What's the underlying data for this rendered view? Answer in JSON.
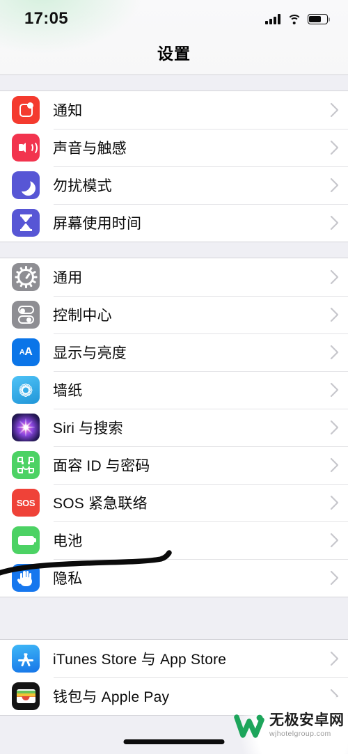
{
  "status_bar": {
    "time": "17:05",
    "signal_icon": "cellular-bars-icon",
    "wifi_icon": "wifi-icon",
    "battery_icon": "battery-icon",
    "battery_level": 62
  },
  "header": {
    "title": "设置"
  },
  "colors": {
    "page_background": "#EFEFF4",
    "row_background": "#FFFFFF",
    "separator": "#E3E3E6",
    "chevron": "#C7C7CC",
    "label": "#0A0A0A",
    "annotation": "#0B0B0B"
  },
  "groups": [
    {
      "id": "group-alerts",
      "rows": [
        {
          "label": "通知",
          "icon": "notifications-icon",
          "icon_color": "#F43A2E"
        },
        {
          "label": "声音与触感",
          "icon": "sounds-haptics-icon",
          "icon_color": "#F2344E"
        },
        {
          "label": "勿扰模式",
          "icon": "do-not-disturb-icon",
          "icon_color": "#5756D5"
        },
        {
          "label": "屏幕使用时间",
          "icon": "screen-time-icon",
          "icon_color": "#5756D5"
        }
      ]
    },
    {
      "id": "group-system",
      "rows": [
        {
          "label": "通用",
          "icon": "gear-icon",
          "icon_color": "#8E8E93"
        },
        {
          "label": "控制中心",
          "icon": "control-center-icon",
          "icon_color": "#8E8E93"
        },
        {
          "label": "显示与亮度",
          "icon": "display-brightness-icon",
          "icon_color": "#0B75E8"
        },
        {
          "label": "墙纸",
          "icon": "wallpaper-icon",
          "icon_color": "#2196D8"
        },
        {
          "label": "Siri 与搜索",
          "icon": "siri-icon",
          "icon_color": "#2A1B5E"
        },
        {
          "label": "面容 ID 与密码",
          "icon": "face-id-icon",
          "icon_color": "#4CD264"
        },
        {
          "label": "SOS 紧急联络",
          "icon": "sos-icon",
          "icon_color": "#EF4238"
        },
        {
          "label": "电池",
          "icon": "battery-settings-icon",
          "icon_color": "#4CD264"
        },
        {
          "label": "隐私",
          "icon": "privacy-hand-icon",
          "icon_color": "#1677EE"
        }
      ]
    },
    {
      "id": "group-stores",
      "rows": [
        {
          "label": "iTunes Store 与 App Store",
          "icon": "app-store-icon",
          "icon_color": "#1675E8"
        },
        {
          "label": "钱包与 Apple Pay",
          "icon": "wallet-icon",
          "icon_color": "#141414"
        }
      ]
    }
  ],
  "annotation": {
    "type": "handdrawn-underline",
    "target_row_label": "电池",
    "color": "#0B0B0B"
  },
  "watermark": {
    "site_name": "无极安卓网",
    "url": "wjhotelgroup.com",
    "logo_color": "#1DA55B"
  },
  "home_indicator": {
    "visible": true
  }
}
